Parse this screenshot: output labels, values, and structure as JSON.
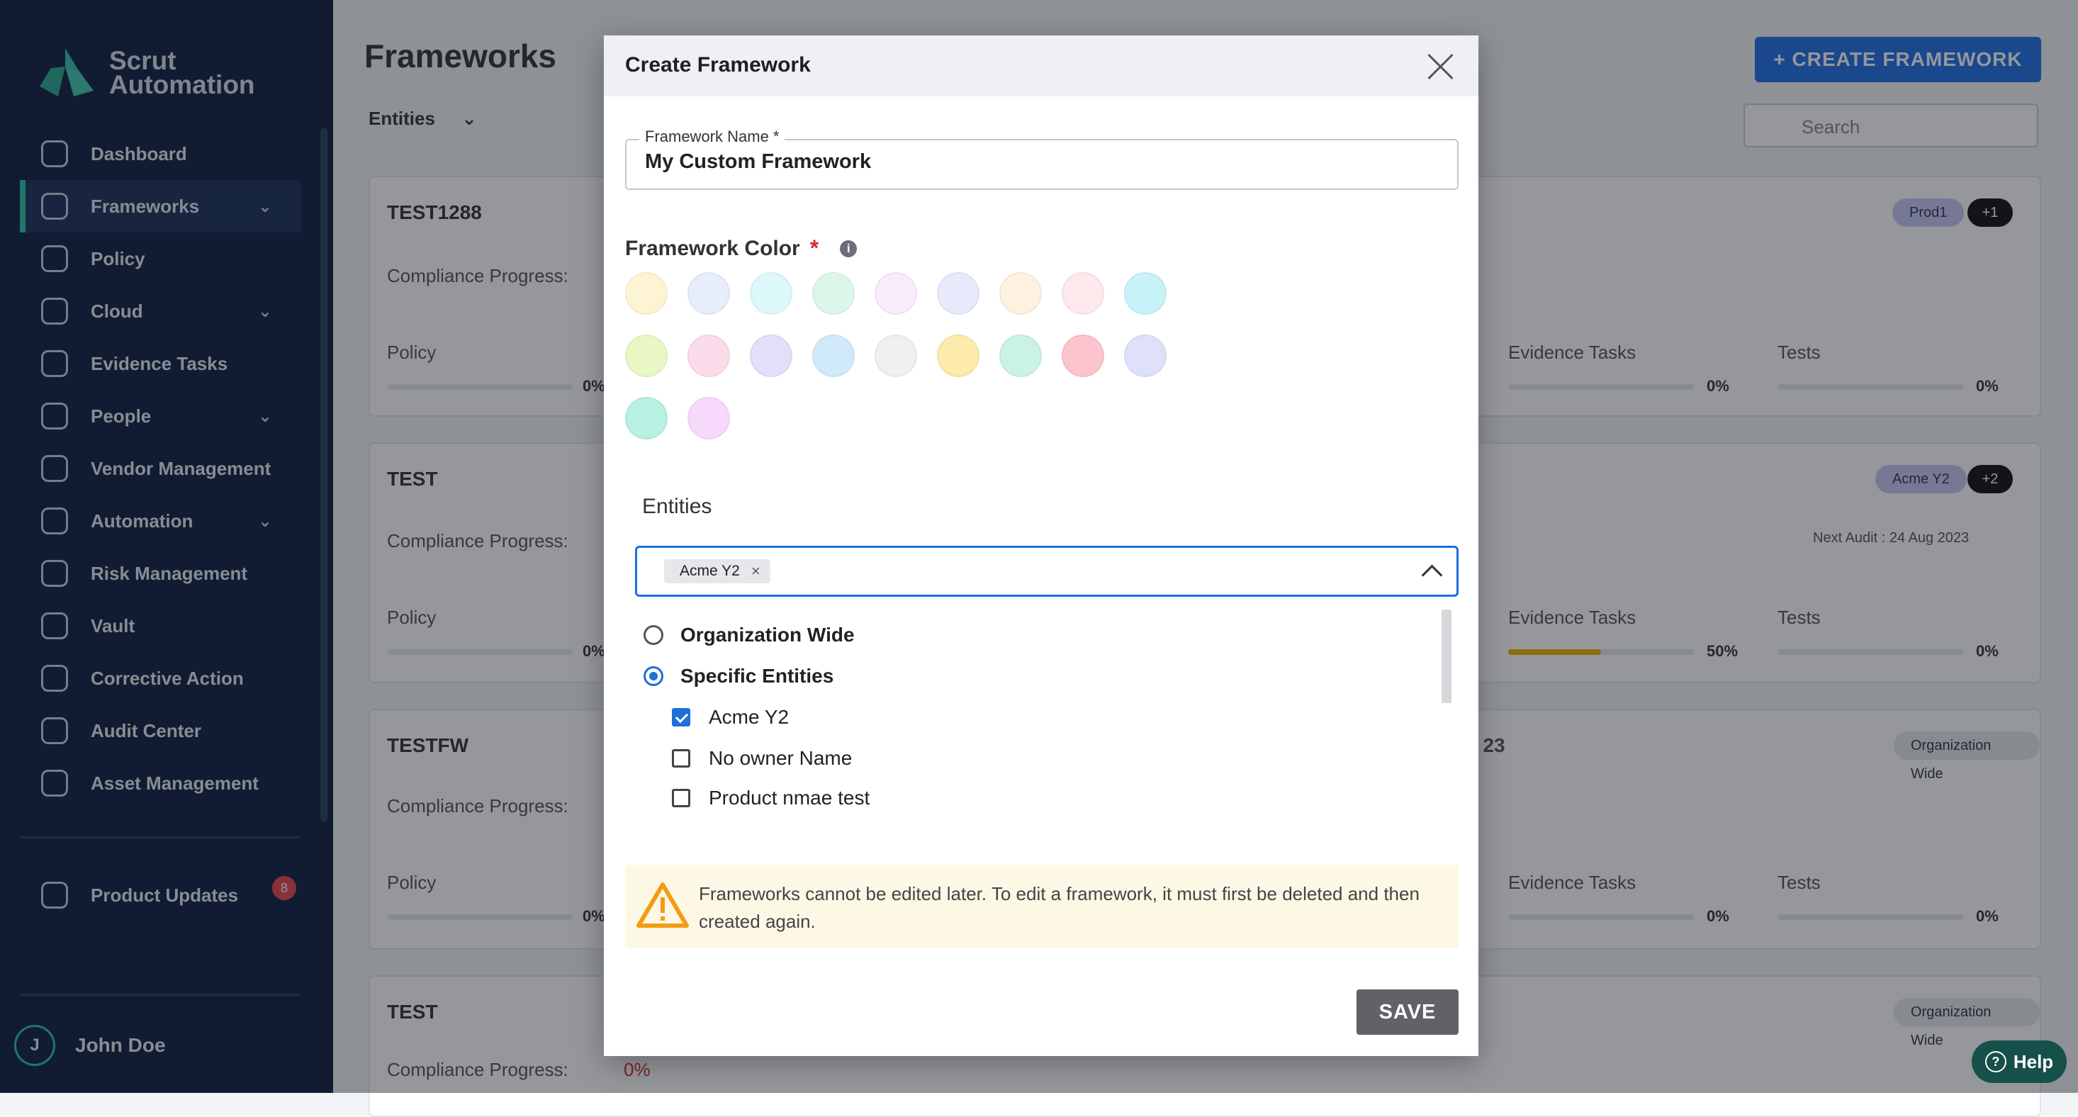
{
  "sidebar": {
    "brand": [
      "Scrut",
      "Automation"
    ],
    "items": [
      {
        "label": "Dashboard",
        "icon": "dashboard-icon",
        "chevron": false
      },
      {
        "label": "Frameworks",
        "icon": "frameworks-icon",
        "chevron": true,
        "active": true
      },
      {
        "label": "Policy",
        "icon": "policy-icon",
        "chevron": false
      },
      {
        "label": "Cloud",
        "icon": "cloud-icon",
        "chevron": true
      },
      {
        "label": "Evidence Tasks",
        "icon": "evidence-icon",
        "chevron": false
      },
      {
        "label": "People",
        "icon": "people-icon",
        "chevron": true
      },
      {
        "label": "Vendor Management",
        "icon": "vendor-icon",
        "chevron": false
      },
      {
        "label": "Automation",
        "icon": "automation-icon",
        "chevron": true
      },
      {
        "label": "Risk Management",
        "icon": "shield-icon",
        "chevron": false
      },
      {
        "label": "Vault",
        "icon": "vault-icon",
        "chevron": false
      },
      {
        "label": "Corrective Action",
        "icon": "check-icon",
        "chevron": false
      },
      {
        "label": "Audit Center",
        "icon": "audit-icon",
        "chevron": false
      },
      {
        "label": "Asset Management",
        "icon": "asset-icon",
        "chevron": false
      }
    ],
    "product_updates": "Product Updates",
    "updates_count": "8",
    "user_initial": "J",
    "user_name": "John Doe"
  },
  "main": {
    "title": "Frameworks",
    "create_button": "+ CREATE FRAMEWORK",
    "entities_filter": "Entities",
    "search_placeholder": "Search",
    "cards": [
      {
        "title": "TEST1288",
        "chip": "Prod1",
        "count": "+1",
        "compliance": "Compliance Progress:",
        "policy": "Policy",
        "policy_val": "0%",
        "evidence": "Evidence Tasks",
        "evidence_val": "0%",
        "tests": "Tests",
        "tests_val": "0%"
      },
      {
        "title": "TEST",
        "chip": "Acme Y2",
        "count": "+2",
        "compliance": "Compliance Progress:",
        "policy": "Policy",
        "policy_val": "0%",
        "evidence": "Evidence Tasks",
        "evidence_val": "50%",
        "tests": "Tests",
        "tests_val": "0%",
        "next_audit": "Next Audit : 24 Aug 2023"
      },
      {
        "title": "TESTFW",
        "chip": "Organization Wide",
        "compliance": "Compliance Progress:",
        "policy": "Policy",
        "policy_val": "0%",
        "evidence": "Evidence Tasks",
        "evidence_val": "0%",
        "tests": "Tests",
        "tests_val": "0%",
        "mid_text": "' 23"
      },
      {
        "title": "TEST",
        "chip": "Organization Wide",
        "compliance": "Compliance Progress:",
        "compliance_val": "0%"
      }
    ]
  },
  "modal": {
    "title": "Create Framework",
    "name_label": "Framework Name *",
    "name_value": "My Custom Framework",
    "color_label": "Framework Color",
    "required_mark": "*",
    "info_glyph": "i",
    "colors": [
      "#fdf4d3",
      "#e8edfc",
      "#dcf8fb",
      "#dcf7ea",
      "#f9ebfb",
      "#e6eafb",
      "#fdf1e0",
      "#fde8ec",
      "#c7f2f8",
      "#e9f7c4",
      "#fcdbeb",
      "#e5defb",
      "#d1eaf9",
      "#eef0f1",
      "#fcebaa",
      "#c9f3e4",
      "#fcc4cc",
      "#dfe1fa",
      "#b8f0e1",
      "#f7d9fb"
    ],
    "entities_label": "Entities",
    "selected_chip": "Acme Y2",
    "chip_remove": "×",
    "options": {
      "org_wide": "Organization Wide",
      "specific": "Specific Entities",
      "entities": [
        "Acme Y2",
        "No owner Name",
        "Product nmae test"
      ]
    },
    "warning": "Frameworks cannot be edited later. To edit a framework, it must first be deleted and then created again.",
    "save_label": "SAVE"
  },
  "help_label": "Help",
  "help_glyph": "?"
}
